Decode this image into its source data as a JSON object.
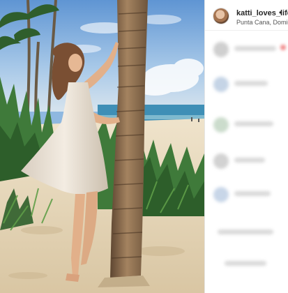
{
  "post": {
    "username": "katti_loves_life",
    "separator": "•",
    "location": "Punta Cana, Domican Republic",
    "image_subject": "woman-by-palm-tree-on-beach"
  },
  "colors": {
    "sky": "#8fb8e0",
    "sea": "#3f8fb6",
    "sand": "#e9dcc3",
    "foliage": "#3f7a3a",
    "palm_trunk": "#8a6a48",
    "dress": "#efe7dc",
    "blurred": "#d9d9d9"
  }
}
